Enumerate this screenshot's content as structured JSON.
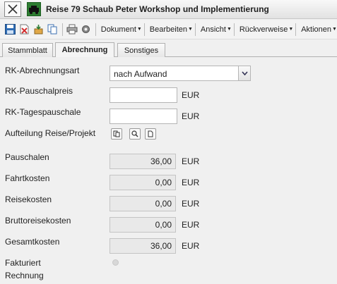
{
  "window": {
    "title": "Reise 79 Schaub Peter Workshop und Implementierung"
  },
  "toolbar": {
    "icons": [
      "save-icon",
      "delete-icon",
      "export-icon",
      "copy-icon",
      "print-icon",
      "settings-icon"
    ],
    "menus": [
      "Dokument",
      "Bearbeiten",
      "Ansicht",
      "Rückverweise",
      "Aktionen"
    ]
  },
  "tabs": [
    "Stammblatt",
    "Abrechnung",
    "Sonstiges"
  ],
  "form": {
    "abrechnungsart": {
      "label": "RK-Abrechnungsart",
      "value": "nach Aufwand"
    },
    "pauschalpreis": {
      "label": "RK-Pauschalpreis",
      "value": "",
      "unit": "EUR"
    },
    "tagespauschale": {
      "label": "RK-Tagespauschale",
      "value": "",
      "unit": "EUR"
    },
    "aufteilung": {
      "label": "Aufteilung Reise/Projekt"
    },
    "pauschalen": {
      "label": "Pauschalen",
      "value": "36,00",
      "unit": "EUR"
    },
    "fahrtkosten": {
      "label": "Fahrtkosten",
      "value": "0,00",
      "unit": "EUR"
    },
    "reisekosten": {
      "label": "Reisekosten",
      "value": "0,00",
      "unit": "EUR"
    },
    "bruttoreisekosten": {
      "label": "Bruttoreisekosten",
      "value": "0,00",
      "unit": "EUR"
    },
    "gesamtkosten": {
      "label": "Gesamtkosten",
      "value": "36,00",
      "unit": "EUR"
    },
    "fakturiert": {
      "label1": "Fakturiert",
      "label2": "Rechnung"
    }
  }
}
